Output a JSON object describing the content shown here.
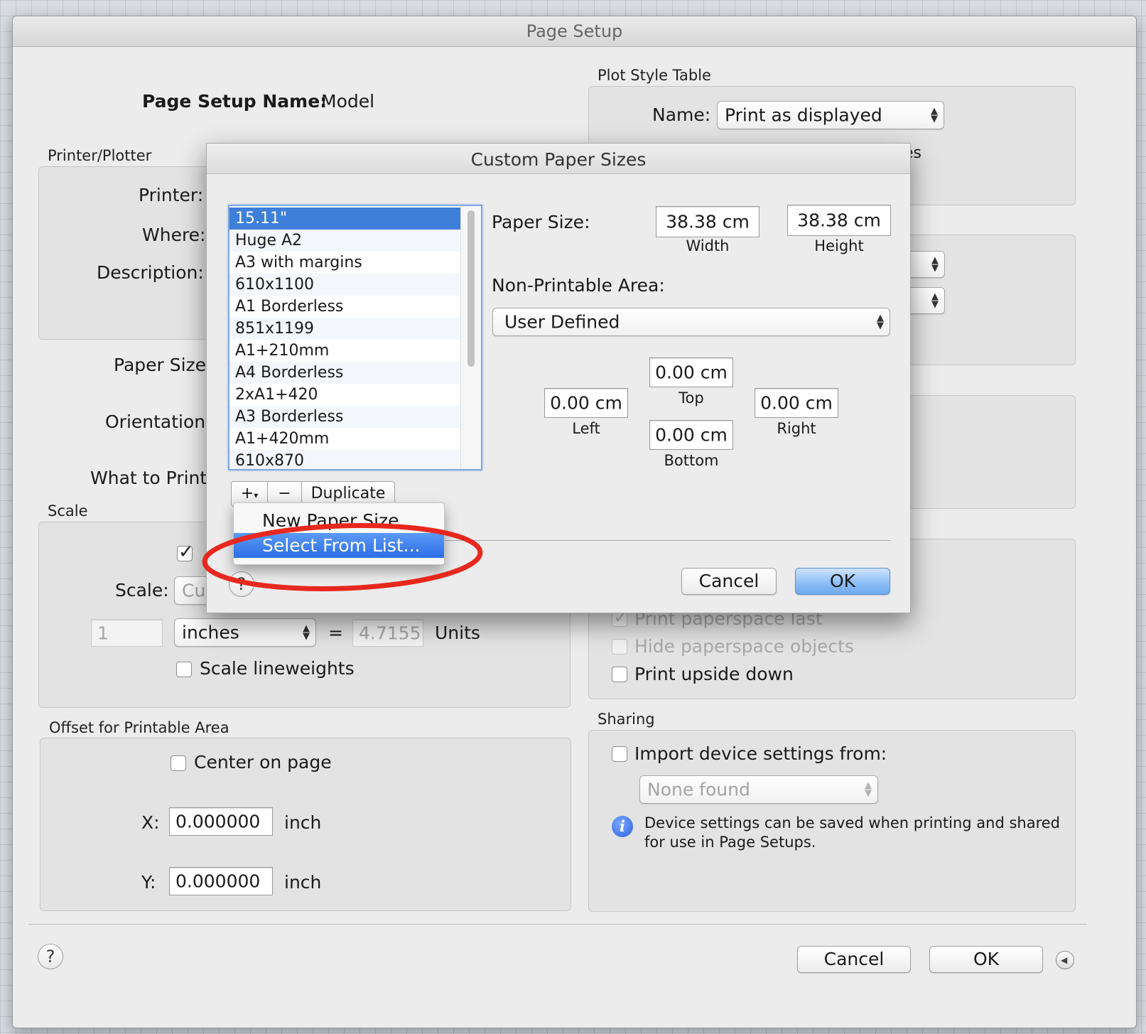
{
  "window": {
    "title": "Page Setup"
  },
  "page_setup_name": {
    "label": "Page Setup Name:",
    "value": "Model"
  },
  "printer_plotter": {
    "group_label": "Printer/Plotter",
    "printer_label": "Printer:",
    "where_label": "Where:",
    "description_label": "Description:"
  },
  "left_labels": {
    "paper_size": "Paper Size:",
    "orientation": "Orientation:",
    "what_to_print": "What to Print:"
  },
  "scale": {
    "group_label": "Scale",
    "fit_checked": true,
    "scale_label": "Scale:",
    "scale_popup_value": "Cu",
    "units_value": "1",
    "units_popup_value": "inches",
    "equals": "=",
    "drawing_units_value": "4.7155",
    "drawing_units_label": "Units",
    "lineweights_label": "Scale lineweights",
    "lineweights_checked": false
  },
  "offset": {
    "group_label": "Offset for Printable Area",
    "center_label": "Center on page",
    "center_checked": false,
    "x_label": "X:",
    "x_value": "0.000000",
    "x_unit": "inch",
    "y_label": "Y:",
    "y_value": "0.000000",
    "y_unit": "inch"
  },
  "plot_style_table": {
    "group_label": "Plot Style Table",
    "name_label": "Name:",
    "name_value": "Print as displayed",
    "partial_text": "es"
  },
  "plot_options": {
    "paperspace_last_label": "Print paperspace last",
    "paperspace_last_checked": true,
    "hide_paperspace_label": "Hide paperspace objects",
    "hide_paperspace_checked": false,
    "upside_down_label": "Print upside down",
    "upside_down_checked": false
  },
  "sharing": {
    "group_label": "Sharing",
    "import_label": "Import device settings from:",
    "import_checked": false,
    "device_popup_value": "None found",
    "info_text_line1": "Device settings can be saved when printing and shared",
    "info_text_line2": "for use in Page Setups."
  },
  "footer": {
    "help": "?",
    "cancel_label": "Cancel",
    "ok_label": "OK"
  },
  "custom_paper_sizes": {
    "title": "Custom Paper Sizes",
    "list": [
      "15.11\"",
      "Huge A2",
      "A3 with margins",
      "610x1100",
      "A1 Borderless",
      "851x1199",
      "A1+210mm",
      "A4 Borderless",
      "2xA1+420",
      "A3 Borderless",
      "A1+420mm",
      "610x870"
    ],
    "selected_index": 0,
    "paper_size_label": "Paper Size:",
    "width_value": "38.38 cm",
    "width_label": "Width",
    "height_value": "38.38 cm",
    "height_label": "Height",
    "non_printable_label": "Non-Printable Area:",
    "non_printable_value": "User Defined",
    "top_value": "0.00 cm",
    "top_label": "Top",
    "left_value": "0.00 cm",
    "left_label": "Left",
    "right_value": "0.00 cm",
    "right_label": "Right",
    "bottom_value": "0.00 cm",
    "bottom_label": "Bottom",
    "add_button": "+",
    "add_menu_arrow": "▾",
    "remove_button": "−",
    "duplicate_label": "Duplicate",
    "cancel_label": "Cancel",
    "ok_label": "OK",
    "help": "?"
  },
  "add_menu": {
    "items": [
      "New Paper Size",
      "Select From List..."
    ],
    "highlighted_index": 1
  },
  "annotation": {
    "color": "#e8281e",
    "shape": "ellipse highlight"
  }
}
